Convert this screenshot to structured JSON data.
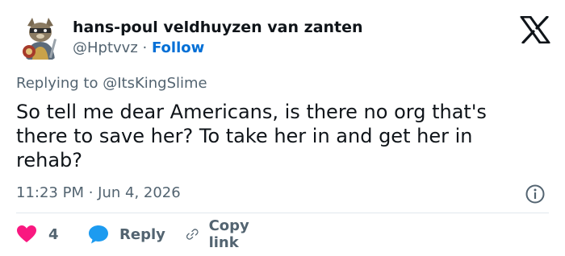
{
  "author": {
    "display_name": "hans-poul veldhuyzen van zanten",
    "handle": "@Hptvvz",
    "separator": "·",
    "follow_label": "Follow"
  },
  "reply_context": "Replying to @ItsKingSlime",
  "tweet_text": "So tell me dear Americans, is there no org that's\nthere to save her? To take her in and get her in\nrehab?",
  "timestamp": "11:23 PM · Jun 4, 2026",
  "actions": {
    "like_count": "4",
    "reply_label": "Reply",
    "copy_link_label": "Copy link"
  },
  "icons": {
    "logo": "x-logo-icon",
    "info": "info-icon",
    "like": "heart-icon",
    "reply": "speech-bubble-icon",
    "copy": "link-icon"
  },
  "colors": {
    "text": "#0f1419",
    "muted": "#536471",
    "follow": "#006fd6",
    "like": "#f91880",
    "reply": "#1d9bf0",
    "divider": "#e1e8ed"
  }
}
